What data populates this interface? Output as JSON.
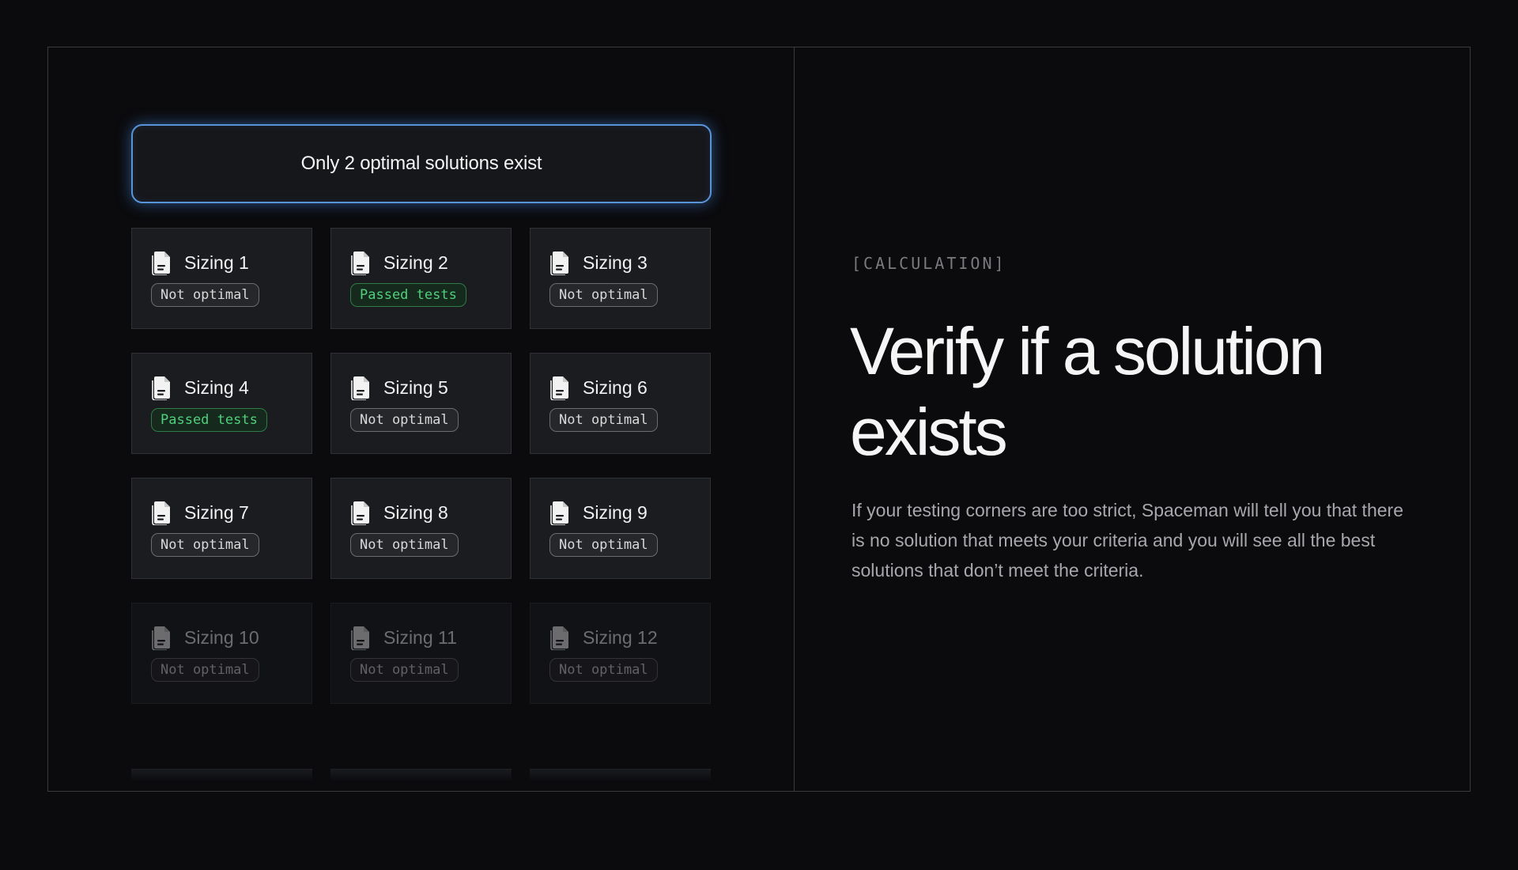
{
  "banner": {
    "text": "Only 2 optimal solutions exist"
  },
  "cards": [
    {
      "title": "Sizing 1",
      "status": "Not optimal"
    },
    {
      "title": "Sizing 2",
      "status": "Passed tests"
    },
    {
      "title": "Sizing 3",
      "status": "Not optimal"
    },
    {
      "title": "Sizing 4",
      "status": "Passed tests"
    },
    {
      "title": "Sizing 5",
      "status": "Not optimal"
    },
    {
      "title": "Sizing 6",
      "status": "Not optimal"
    },
    {
      "title": "Sizing 7",
      "status": "Not optimal"
    },
    {
      "title": "Sizing 8",
      "status": "Not optimal"
    },
    {
      "title": "Sizing 9",
      "status": "Not optimal"
    },
    {
      "title": "Sizing 10",
      "status": "Not optimal"
    },
    {
      "title": "Sizing 11",
      "status": "Not optimal"
    },
    {
      "title": "Sizing 12",
      "status": "Not optimal"
    }
  ],
  "icons": {
    "card_icon": "document-icon"
  },
  "section": {
    "tag": "[CALCULATION]",
    "headline": "Verify if a solution exists",
    "description": "If your testing corners are too strict, Spaceman will tell you that there is no solution that meets your criteria and you will see all the best solutions that don’t meet the criteria."
  },
  "colors": {
    "background": "#0b0b0e",
    "accent_glow": "#5a94d8",
    "pass_green": "#4fd07c",
    "card_bg": "#1b1c20"
  }
}
